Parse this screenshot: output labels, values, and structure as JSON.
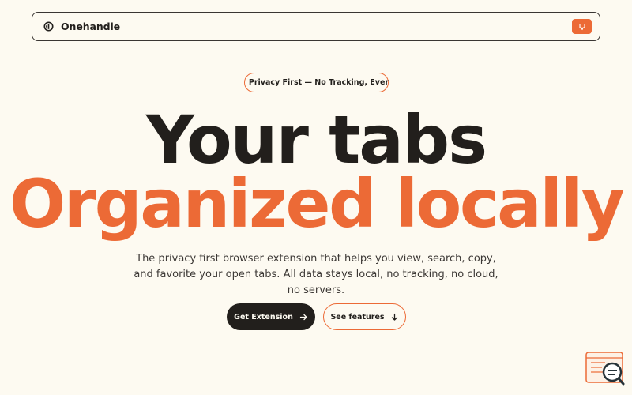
{
  "colors": {
    "background": "#fdfaf1",
    "text": "#221f1c",
    "accent": "#ec6a36"
  },
  "navbar": {
    "logo_icon": "onehandle-logo-icon",
    "brand_name": "Onehandle",
    "cta_icon": "extension-icon"
  },
  "badge": {
    "icon": "shield-icon",
    "text": "Privacy First — No Tracking, Ever"
  },
  "hero": {
    "line1": "Your tabs",
    "line2": "Organized locally"
  },
  "description": "The privacy first browser extension that helps you view, search, copy, and favorite your open tabs. All data stays local, no tracking, no cloud, no servers.",
  "buttons": {
    "primary_label": "Get Extension",
    "primary_icon": "arrow-right-icon",
    "secondary_label": "See features",
    "secondary_icon": "arrow-down-icon"
  },
  "widget": {
    "icon": "search-chat-icon"
  }
}
